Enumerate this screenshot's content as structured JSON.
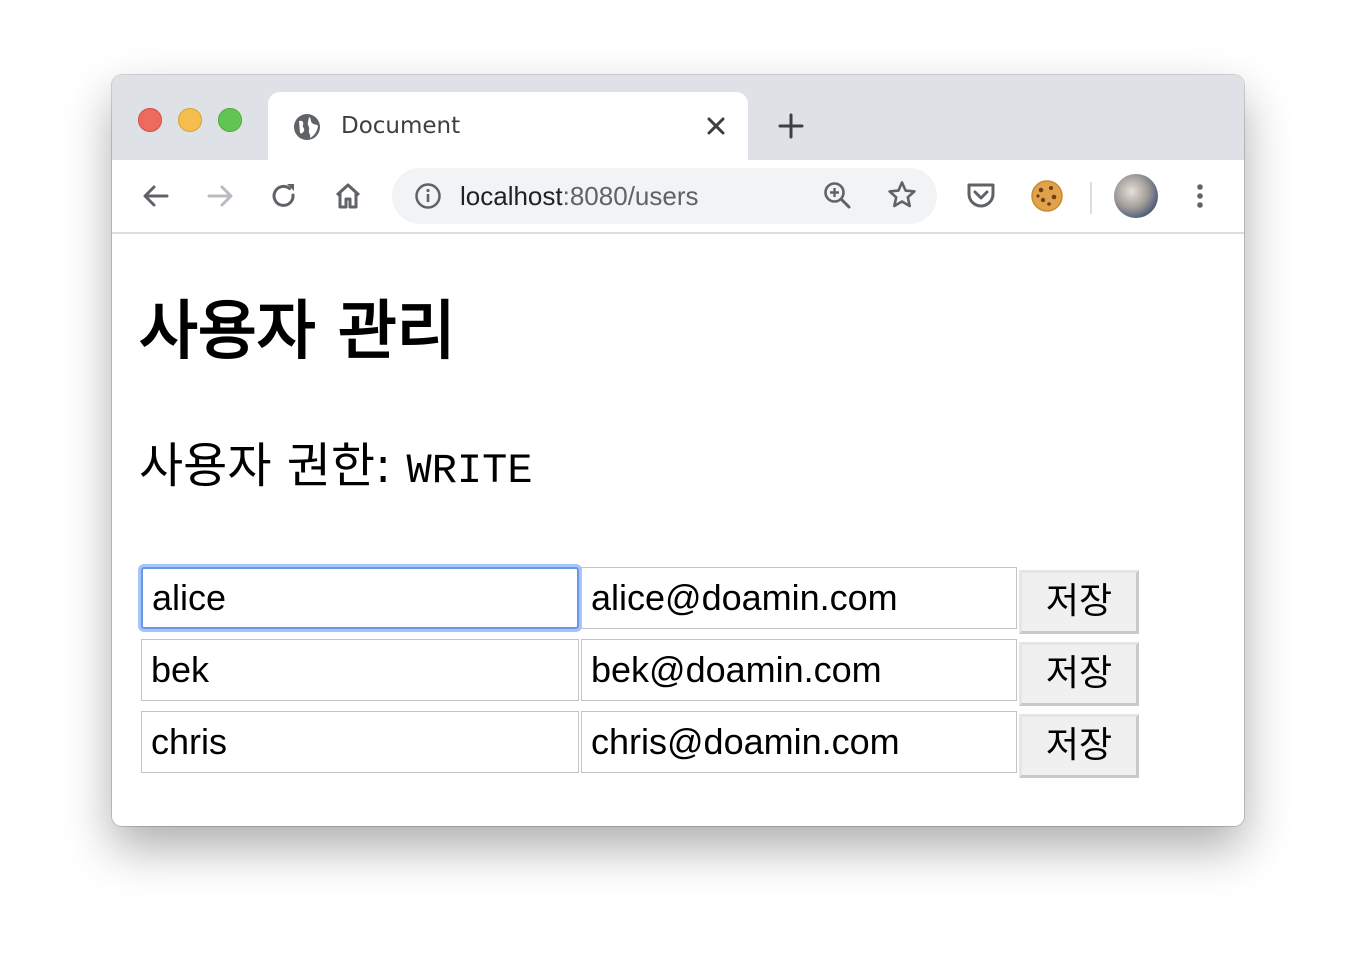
{
  "browser": {
    "tab": {
      "title": "Document",
      "favicon": "globe-icon"
    },
    "address_bar": {
      "host": "localhost",
      "rest": ":8080/users"
    },
    "extensions": [
      "pocket-icon",
      "cookie-icon"
    ],
    "icons": {
      "back": "arrow-left-icon",
      "forward": "arrow-right-icon",
      "reload": "reload-icon",
      "home": "home-icon",
      "zoom": "zoom-in-icon",
      "bookmark": "star-icon",
      "menu": "kebab-menu-icon"
    }
  },
  "page": {
    "title": "사용자 관리",
    "role_label": "사용자 권한: ",
    "role_value": "WRITE"
  },
  "users": [
    {
      "name": "alice",
      "email": "alice@doamin.com",
      "save_label": "저장",
      "focused": true
    },
    {
      "name": "bek",
      "email": "bek@doamin.com",
      "save_label": "저장",
      "focused": false
    },
    {
      "name": "chris",
      "email": "chris@doamin.com",
      "save_label": "저장",
      "focused": false
    }
  ]
}
